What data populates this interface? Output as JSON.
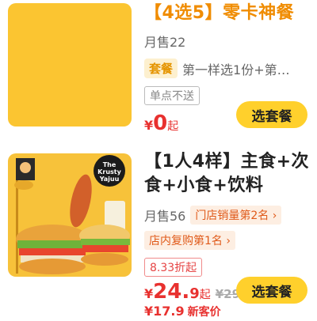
{
  "items": [
    {
      "title_bracket": "【4选5】",
      "title_rest": "零卡神餐",
      "sales": "月售22",
      "set_tag": "套餐",
      "desc": "第一样选1份+第…",
      "delivery_tag": "单点不送",
      "price_symbol": "¥",
      "price": "0",
      "price_suffix": "起",
      "button": "选套餐"
    },
    {
      "title_line1": "【1人4样】主食+次",
      "title_line2": "食+小食+饮料",
      "sales": "月售56",
      "rank_store": "门店销量第2名",
      "rank_repurchase": "店内复购第1名",
      "discount": "8.33折起",
      "price_symbol": "¥",
      "price_int": "24.",
      "price_dec": "9",
      "price_suffix": "起",
      "original_price": "¥29.9",
      "new_price_partial": "¥17.9",
      "new_customer_label": "新客价",
      "button": "选套餐",
      "image_sign_text": "The Krusty Yajuu"
    }
  ],
  "colors": {
    "accent_yellow": "#ffd02c",
    "price_red": "#e8312f",
    "rank_orange": "#e05a1a"
  }
}
